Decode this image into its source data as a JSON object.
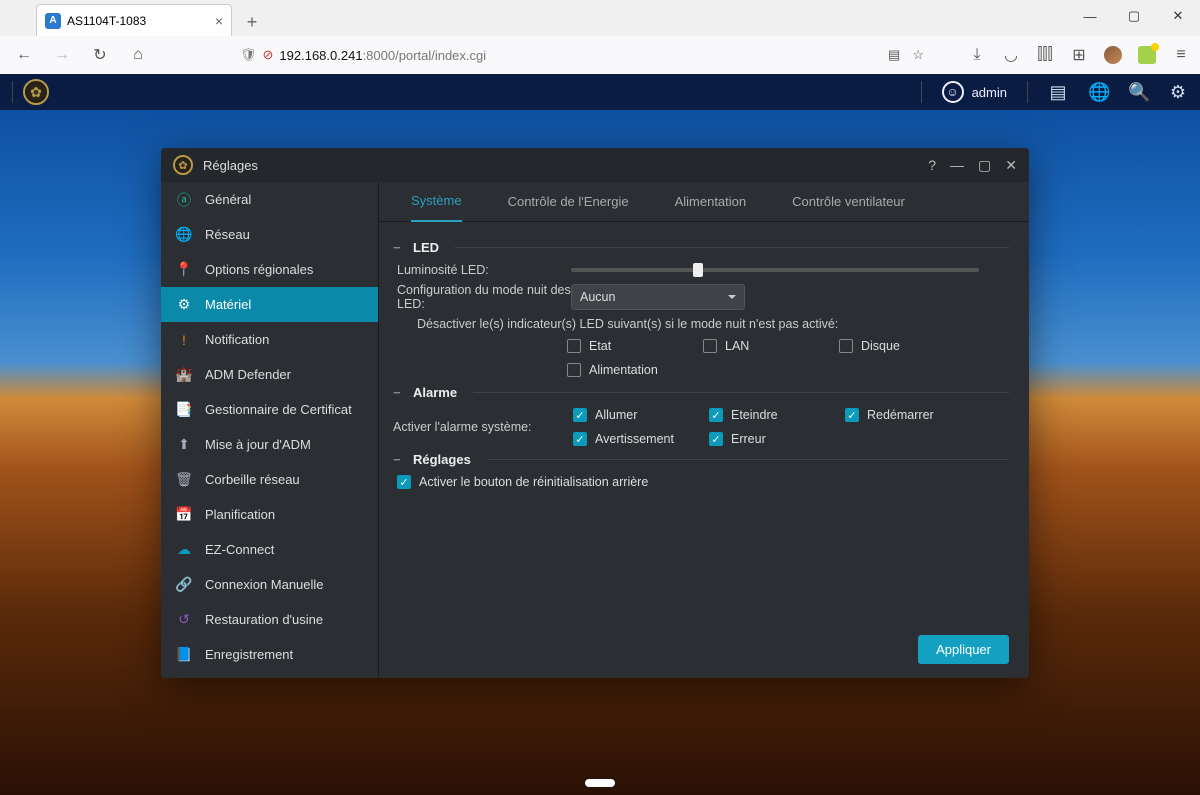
{
  "browser": {
    "tab_title": "AS1104T-1083",
    "url_prefix": "192.168.0.241",
    "url_suffix": ":8000/portal/index.cgi"
  },
  "app_taskbar": {
    "username": "admin"
  },
  "window": {
    "title": "Réglages"
  },
  "sidebar": {
    "items": [
      {
        "label": "Général",
        "icon": "ⓐ",
        "cls": "i-teal"
      },
      {
        "label": "Réseau",
        "icon": "🌐",
        "cls": "i-blue"
      },
      {
        "label": "Options régionales",
        "icon": "📍",
        "cls": "i-pink"
      },
      {
        "label": "Matériel",
        "icon": "⚙",
        "cls": ""
      },
      {
        "label": "Notification",
        "icon": "!",
        "cls": "i-orange"
      },
      {
        "label": "ADM Defender",
        "icon": "🏰",
        "cls": "i-red"
      },
      {
        "label": "Gestionnaire de Certificat",
        "icon": "📑",
        "cls": "i-yellow"
      },
      {
        "label": "Mise à jour d'ADM",
        "icon": "⬆",
        "cls": "i-gray"
      },
      {
        "label": "Corbeille réseau",
        "icon": "🗑",
        "cls": "i-gray"
      },
      {
        "label": "Planification",
        "icon": "📅",
        "cls": "i-cyan"
      },
      {
        "label": "EZ-Connect",
        "icon": "☁",
        "cls": "i-cyan"
      },
      {
        "label": "Connexion Manuelle",
        "icon": "🔗",
        "cls": "i-green"
      },
      {
        "label": "Restauration d'usine",
        "icon": "↺",
        "cls": "i-purple"
      },
      {
        "label": "Enregistrement",
        "icon": "📘",
        "cls": "i-blue"
      }
    ],
    "active_index": 3
  },
  "tabs": {
    "items": [
      "Système",
      "Contrôle de l'Energie",
      "Alimentation",
      "Contrôle ventilateur"
    ],
    "active_index": 0
  },
  "sections": {
    "led": {
      "title": "LED",
      "brightness_label": "Luminosité LED:",
      "night_mode_label": "Configuration du mode nuit des LED:",
      "night_mode_value": "Aucun",
      "disable_note": "Désactiver le(s) indicateur(s) LED suivant(s) si le mode nuit n'est pas activé:",
      "checks": {
        "etat": "Etat",
        "lan": "LAN",
        "disque": "Disque",
        "alimentation": "Alimentation"
      }
    },
    "alarme": {
      "title": "Alarme",
      "enable_label": "Activer l'alarme système:",
      "checks": {
        "allumer": "Allumer",
        "eteindre": "Eteindre",
        "redemarrer": "Redémarrer",
        "avertissement": "Avertissement",
        "erreur": "Erreur"
      }
    },
    "reglages": {
      "title": "Réglages",
      "reset_label": "Activer le bouton de réinitialisation arrière"
    }
  },
  "apply_label": "Appliquer"
}
